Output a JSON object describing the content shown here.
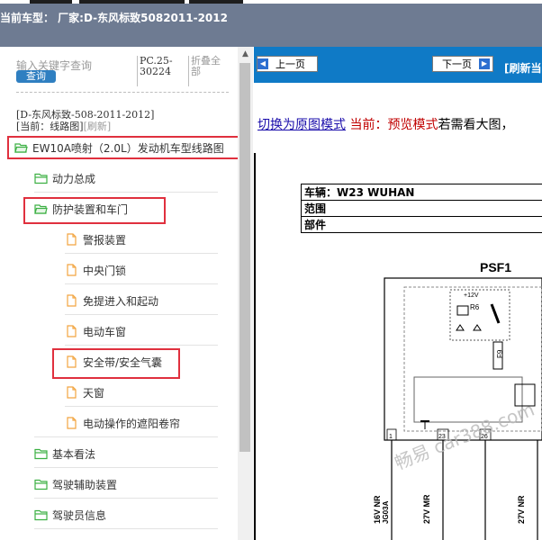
{
  "window": {
    "header_title": "当前车型： 厂家:D-东风标致5082011-2012"
  },
  "search": {
    "placeholder": "输入关键字查询",
    "query_button": "查询",
    "pc_code": "PC.25-30224",
    "collapse_all": "折叠全部"
  },
  "breadcrumb": {
    "path": "[D-东风标致-508-2011-2012]",
    "current": "[当前：线路图]",
    "refresh": "[刷新]"
  },
  "tree": {
    "root": "EW10A喷射（2.0L）发动机车型线路图",
    "level1": [
      "动力总成",
      "防护装置和车门"
    ],
    "level2": [
      "警报装置",
      "中央门锁",
      "免提进入和起动",
      "电动车窗",
      "安全带/安全气囊",
      "天窗",
      "电动操作的遮阳卷帘"
    ],
    "level1_after": [
      "基本看法",
      "驾驶辅助装置",
      "驾驶员信息"
    ]
  },
  "nav": {
    "prev": "上一页",
    "next": "下一页",
    "refresh": "[刷新当"
  },
  "preview": {
    "switch_link": "切换为原图模式",
    "current_mode": "当前：预览模式",
    "hint": "若需看大图，"
  },
  "vehicle_table": {
    "vehicle": "车辆：W23 WUHAN",
    "range": "范围",
    "parts": "部件"
  },
  "diagram": {
    "title": "PSF1",
    "relay": "R6",
    "voltage": "+12V",
    "fuse": "F9",
    "pins": [
      "1",
      "23",
      "26"
    ],
    "wires": [
      "16V NR",
      "JG03A",
      "27V MR",
      "27V NR"
    ],
    "watermark": "畅易 car388.com"
  },
  "colors": {
    "header_bg": "#6e7b92",
    "nav_bg": "#0f7ac6",
    "highlight": "#e0303e",
    "folder": "#3cb043",
    "page": "#f2a540",
    "link": "#1a0dab"
  }
}
